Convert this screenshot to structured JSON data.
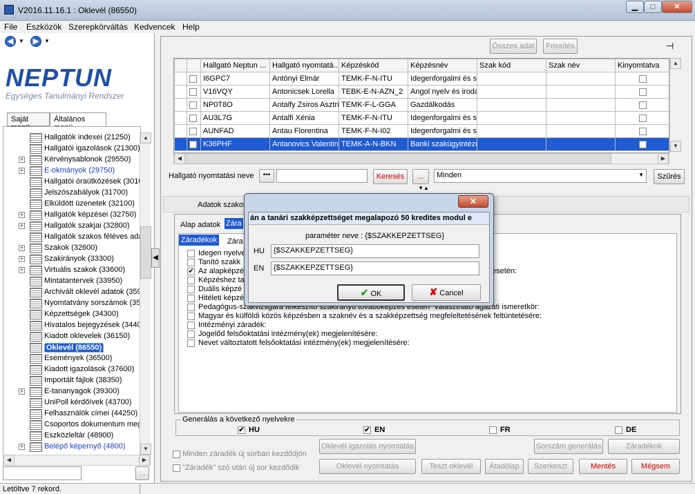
{
  "window": {
    "title": "V2016.11.16.1 : Oklevél (86550)",
    "min": "▁",
    "max": "□",
    "close": "✕"
  },
  "menu": [
    "File",
    "Eszközök",
    "Szerepkörváltás",
    "Kedvencek",
    "Help"
  ],
  "logo": {
    "name": "NEPTUN",
    "subtitle": "Egységes Tanulmányi Rendszer"
  },
  "lefttabs": [
    "Saját menü",
    "Általános menü"
  ],
  "tree": [
    {
      "label": "Hallgatók indexei (21250)",
      "plus": false,
      "blue": false
    },
    {
      "label": "Hallgatói igazolások (21300)",
      "plus": false,
      "blue": false
    },
    {
      "label": "Kérvénysablonok (29550)",
      "plus": true,
      "blue": false
    },
    {
      "label": "E-okmányok (29750)",
      "plus": true,
      "blue": true
    },
    {
      "label": "Hallgatói óraütközések (3010",
      "plus": false,
      "blue": false
    },
    {
      "label": "Jelszószabályok (31700)",
      "plus": false,
      "blue": false
    },
    {
      "label": "Elküldött üzenetek (32100)",
      "plus": false,
      "blue": false
    },
    {
      "label": "Hallgatók képzései (32750)",
      "plus": true,
      "blue": false
    },
    {
      "label": "Hallgatók szakjai (32800)",
      "plus": true,
      "blue": false
    },
    {
      "label": "Hallgatók szakos féléves ada",
      "plus": false,
      "blue": false
    },
    {
      "label": "Szakok (32600)",
      "plus": true,
      "blue": false
    },
    {
      "label": "Szakirányok (33300)",
      "plus": true,
      "blue": false
    },
    {
      "label": "Virtuális szakok (33600)",
      "plus": true,
      "blue": false
    },
    {
      "label": "Mintatantervek (33950)",
      "plus": false,
      "blue": false
    },
    {
      "label": "Archivált oklevél adatok (359",
      "plus": false,
      "blue": false
    },
    {
      "label": "Nyomtatvány sorszámok (359",
      "plus": false,
      "blue": false
    },
    {
      "label": "Képzettségek (34300)",
      "plus": false,
      "blue": false
    },
    {
      "label": "Hivatalos bejegyzések (3440",
      "plus": false,
      "blue": false
    },
    {
      "label": "Kiadott oklevelek (36150)",
      "plus": false,
      "blue": false
    },
    {
      "label": "Oklevél (86550)",
      "plus": false,
      "blue": false,
      "selected": true
    },
    {
      "label": "Események (36500)",
      "plus": false,
      "blue": false
    },
    {
      "label": "Kiadott igazolások (37600)",
      "plus": false,
      "blue": false
    },
    {
      "label": "Importált fájlok (38350)",
      "plus": false,
      "blue": false
    },
    {
      "label": "E-tananyagok (39300)",
      "plus": true,
      "blue": false
    },
    {
      "label": "UniPoll kérdőívek (43700)",
      "plus": false,
      "blue": false
    },
    {
      "label": "Felhasználók címei (44250)",
      "plus": false,
      "blue": false
    },
    {
      "label": "Csoportos dokumentum megte",
      "plus": false,
      "blue": false
    },
    {
      "label": "Eszközleltár (48900)",
      "plus": false,
      "blue": false
    },
    {
      "label": "Belépő képernyő (4800)",
      "plus": true,
      "blue": true
    }
  ],
  "toolbar": {
    "all_data": "Összes adat",
    "refresh": "Frissítés"
  },
  "grid": {
    "headers": [
      "Hallgató Neptun ...",
      "Hallgató nyomtatá...",
      "Képzéskód",
      "Képzésnév",
      "Szak kód",
      "Szak név",
      "Kinyomtatva"
    ],
    "rows": [
      [
        "I6GPC7",
        "Antónyi Elmár",
        "TEMK-F-N-ITU",
        "Idegenforgalmi és sz",
        "",
        "",
        ""
      ],
      [
        "V16VQY",
        "Antonicsek Lorella",
        "TEBK-E-N-AZN_2",
        "Angol nyelv és iroda",
        "",
        "",
        ""
      ],
      [
        "NP0T8O",
        "Antalfy Zsiros Asztric",
        "TEMK-F-L-GGA",
        "Gazdálkodás",
        "",
        "",
        ""
      ],
      [
        "AU3L7G",
        "Antalfi Xénia",
        "TEMK-F-N-ITU",
        "Idegenforgalmi és sz",
        "",
        "",
        ""
      ],
      [
        "AUNFAD",
        "Antau Florentina",
        "TEMK-F-N-I02",
        "Idegenforgalmi és sz",
        "",
        "",
        ""
      ],
      [
        "K36PHF",
        "Antanovics Valentina",
        "TEMK-A-N-BKN",
        "Banki szakügyintéző",
        "",
        "",
        ""
      ]
    ],
    "selected": 5
  },
  "search": {
    "label": "Hallgató nyomtatási neve",
    "dots": "•••",
    "button": "Keresés",
    "more": "...",
    "filter": "Minden",
    "filter_button": "Szűrés"
  },
  "details": {
    "label": "Adatok szakos",
    "tab1": "Alap adatok",
    "tab2": "Zára",
    "subtab1": "Záradékok",
    "subtab2": "Zára"
  },
  "clauses": [
    {
      "label": "Idegen nyelve",
      "checked": false
    },
    {
      "label": "Tanító szakk",
      "checked": false
    },
    {
      "label": "Az alapképzé",
      "checked": true,
      "suffix": "esetén:"
    },
    {
      "label": "Képzéshez ta",
      "checked": false
    },
    {
      "label": "Duális képzé",
      "checked": false
    },
    {
      "label": "Hitéleti képzé",
      "checked": false
    },
    {
      "label": "Pedagógus-szakvizsgára felkészítő szakirányú továbbképzés esetén \"választható ágazati ismeretkör:",
      "checked": false
    },
    {
      "label": "Magyar és külföldi közös képzésben a szaknév és a szakképzettség megfeleltetésének feltüntetésére:",
      "checked": false
    },
    {
      "label": "Intézményi záradék:",
      "checked": false
    },
    {
      "label": "Jogelőd felsőoktatási intézmény(ek) megjelenítésére:",
      "checked": false
    },
    {
      "label": "Nevet változtatott felsőoktatási intézmény(ek) megjelenítésére:",
      "checked": false
    }
  ],
  "languages": {
    "title": "Generálás a következő nyelvekre",
    "items": [
      {
        "code": "HU",
        "checked": true
      },
      {
        "code": "EN",
        "checked": true
      },
      {
        "code": "FR",
        "checked": false
      },
      {
        "code": "DE",
        "checked": false
      }
    ]
  },
  "options": [
    "Minden záradék új sorban kezdődjön",
    "\"Záradék\" szó után új sor kezdődik"
  ],
  "bottom_buttons": {
    "igazolas": "Oklevél igazolás nyomtatás",
    "sorszam": "Sorszám generálás",
    "zaradekok": "Záradékok",
    "nyomtatas": "Oklevél nyomtatás",
    "teszt": "Teszt oklevél",
    "atadolap": "Átadólap",
    "szerkeszt": "Szerkeszt",
    "mentes": "Mentés",
    "megsem": "Mégsem"
  },
  "dialog": {
    "header_text": "án a tanári szakképzettséget megalapozó 50 kredites modul e",
    "param_label": "paraméter neve : {$SZAKKEPZETTSEG}",
    "hu_label": "HU",
    "hu_value": "{$SZAKKEPZETTSEG}",
    "en_label": "EN",
    "en_value": "{$SZAKKEPZETTSEG}",
    "ok": "OK",
    "cancel": "Cancel",
    "close": "✕"
  },
  "status": "Letöltve 7 rekord."
}
